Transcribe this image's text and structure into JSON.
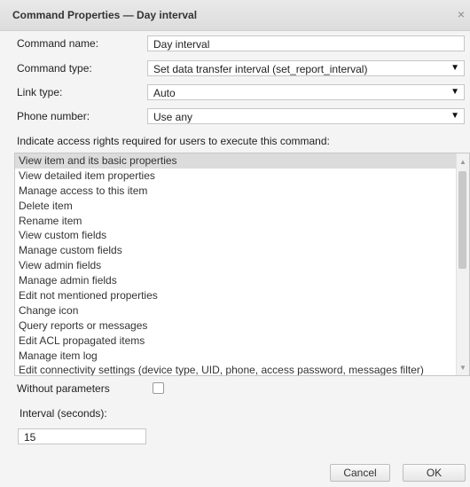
{
  "dialog": {
    "title": "Command Properties — Day interval",
    "close_glyph": "×"
  },
  "form": {
    "command_name_label": "Command name:",
    "command_name_value": "Day interval",
    "command_type_label": "Command type:",
    "command_type_value": "Set data transfer interval (set_report_interval)",
    "link_type_label": "Link type:",
    "link_type_value": "Auto",
    "phone_number_label": "Phone number:",
    "phone_number_value": "Use any"
  },
  "access": {
    "title": "Indicate access rights required for users to execute this command:",
    "items": [
      {
        "label": "View item and its basic properties",
        "selected": true
      },
      {
        "label": "View detailed item properties",
        "selected": false
      },
      {
        "label": "Manage access to this item",
        "selected": false
      },
      {
        "label": "Delete item",
        "selected": false
      },
      {
        "label": "Rename item",
        "selected": false
      },
      {
        "label": "View custom fields",
        "selected": false
      },
      {
        "label": "Manage custom fields",
        "selected": false
      },
      {
        "label": "View admin fields",
        "selected": false
      },
      {
        "label": "Manage admin fields",
        "selected": false
      },
      {
        "label": "Edit not mentioned properties",
        "selected": false
      },
      {
        "label": "Change icon",
        "selected": false
      },
      {
        "label": "Query reports or messages",
        "selected": false
      },
      {
        "label": "Edit ACL propagated items",
        "selected": false
      },
      {
        "label": "Manage item log",
        "selected": false
      },
      {
        "label": "Edit connectivity settings (device type, UID, phone, access password, messages filter)",
        "selected": false
      }
    ]
  },
  "params": {
    "without_parameters_label": "Without parameters",
    "without_parameters_checked": false,
    "interval_label": "Interval (seconds):",
    "interval_value": "15"
  },
  "buttons": {
    "cancel_label": "Cancel",
    "ok_label": "OK"
  }
}
